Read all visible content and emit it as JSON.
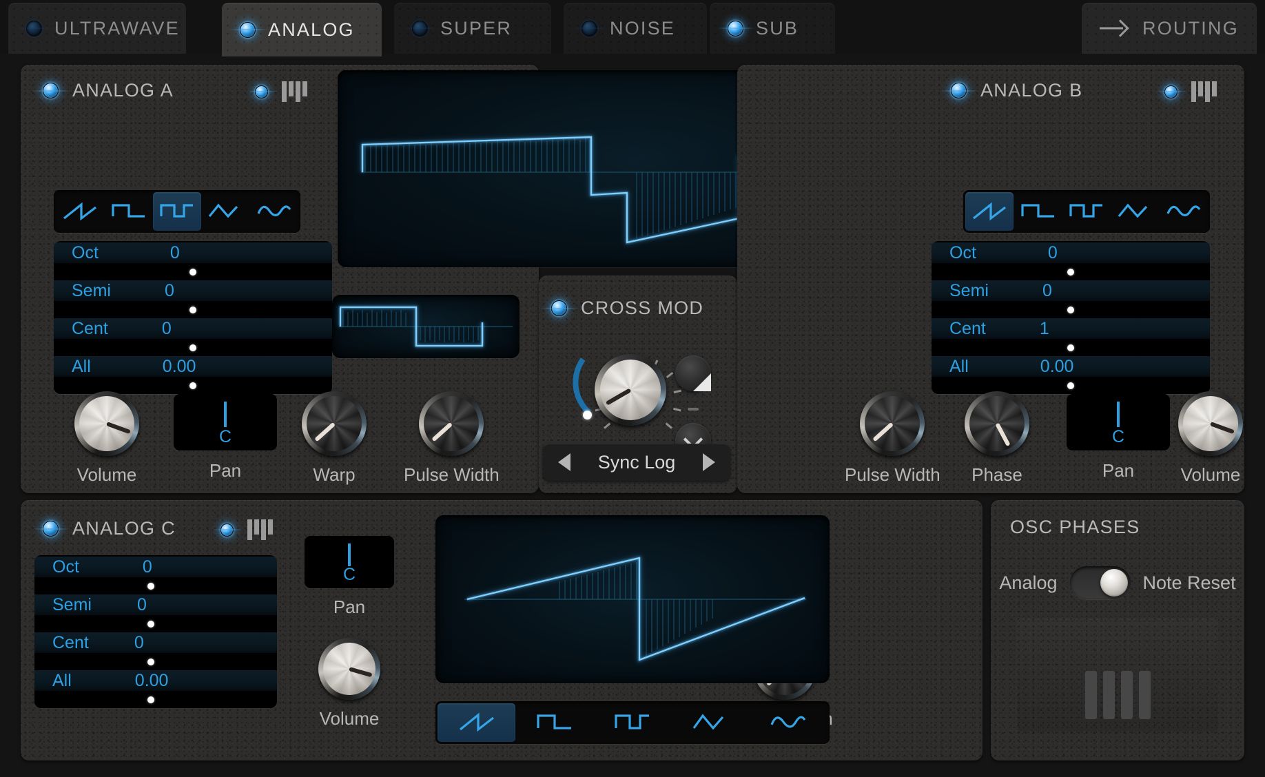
{
  "app": {
    "active_tab": "ANALOG"
  },
  "tabs": [
    {
      "label": "ULTRAWAVE",
      "led": "off",
      "active": false,
      "icon": "led-indicator"
    },
    {
      "label": "ANALOG",
      "led": "on",
      "active": true,
      "icon": "led-indicator"
    },
    {
      "label": "SUPER",
      "led": "off",
      "active": false,
      "icon": "led-indicator"
    },
    {
      "label": "NOISE",
      "led": "off",
      "active": false,
      "icon": "led-indicator"
    },
    {
      "label": "SUB",
      "led": "on",
      "active": false,
      "icon": "led-indicator"
    }
  ],
  "routing_tab": {
    "label": "ROUTING",
    "icon": "arrow-right-icon"
  },
  "waveform_names": [
    "saw-up-icon",
    "saw-down-icon",
    "square-icon",
    "triangle-icon",
    "sine-icon"
  ],
  "analog_a": {
    "title": "ANALOG A",
    "power_led": "on",
    "key_led": "on",
    "key_icon": "keyboard-icon",
    "selected_wave": 2,
    "params": [
      {
        "label": "Oct",
        "value": "0",
        "dot": 50
      },
      {
        "label": "Semi",
        "value": "0",
        "dot": 50
      },
      {
        "label": "Cent",
        "value": "0",
        "dot": 50
      },
      {
        "label": "All",
        "value": "0.00",
        "dot": 50
      }
    ],
    "knobs": [
      {
        "label": "Volume",
        "angle": 96,
        "style": "light"
      },
      {
        "label": "Warp",
        "angle": 215,
        "style": "dark"
      },
      {
        "label": "Pulse Width",
        "angle": 215,
        "style": "dark"
      }
    ],
    "pan": {
      "label": "Pan",
      "value": "C"
    }
  },
  "analog_b": {
    "title": "ANALOG B",
    "power_led": "on",
    "key_led": "on",
    "key_icon": "keyboard-icon",
    "selected_wave": 0,
    "params": [
      {
        "label": "Oct",
        "value": "0",
        "dot": 50
      },
      {
        "label": "Semi",
        "value": "0",
        "dot": 50
      },
      {
        "label": "Cent",
        "value": "1",
        "dot": 50
      },
      {
        "label": "All",
        "value": "0.00",
        "dot": 50
      }
    ],
    "knobs": [
      {
        "label": "Pulse Width",
        "angle": 215,
        "style": "dark"
      },
      {
        "label": "Phase",
        "angle": 145,
        "style": "dark"
      },
      {
        "label": "Volume",
        "angle": 96,
        "style": "light"
      }
    ],
    "pan": {
      "label": "Pan",
      "value": "C"
    }
  },
  "analog_c": {
    "title": "ANALOG C",
    "power_led": "on",
    "key_led": "on",
    "key_icon": "keyboard-icon",
    "selected_wave": 0,
    "params": [
      {
        "label": "Oct",
        "value": "0",
        "dot": 50
      },
      {
        "label": "Semi",
        "value": "0",
        "dot": 50
      },
      {
        "label": "Cent",
        "value": "0",
        "dot": 50
      },
      {
        "label": "All",
        "value": "0.00",
        "dot": 50
      }
    ],
    "pan": {
      "label": "Pan",
      "value": "C"
    },
    "volume": {
      "label": "Volume",
      "angle": 96,
      "style": "light"
    },
    "pulse_width": {
      "label": "Pulse Width",
      "angle": 215,
      "style": "dark"
    }
  },
  "cross_mod": {
    "title": "CROSS MOD",
    "led": "on",
    "knob_angle": 120,
    "arc_value": 0.17,
    "mod_button": "mod-amount-icon",
    "menu_button": "chevron-down-icon",
    "sync": {
      "value": "Sync Log",
      "prev": "prev-arrow-icon",
      "next": "next-arrow-icon"
    }
  },
  "osc_phases": {
    "title": "OSC PHASES",
    "left_label": "Analog",
    "right_label": "Note Reset",
    "toggle_state": "right",
    "graphic": "phase-bars-icon"
  },
  "colors": {
    "accent_blue": "#2e9fe0",
    "wave_blue": "#36a5e8",
    "scope_line": "#7fd0ff",
    "panel": "#2e2d2c",
    "text": "#b7b7b7"
  }
}
